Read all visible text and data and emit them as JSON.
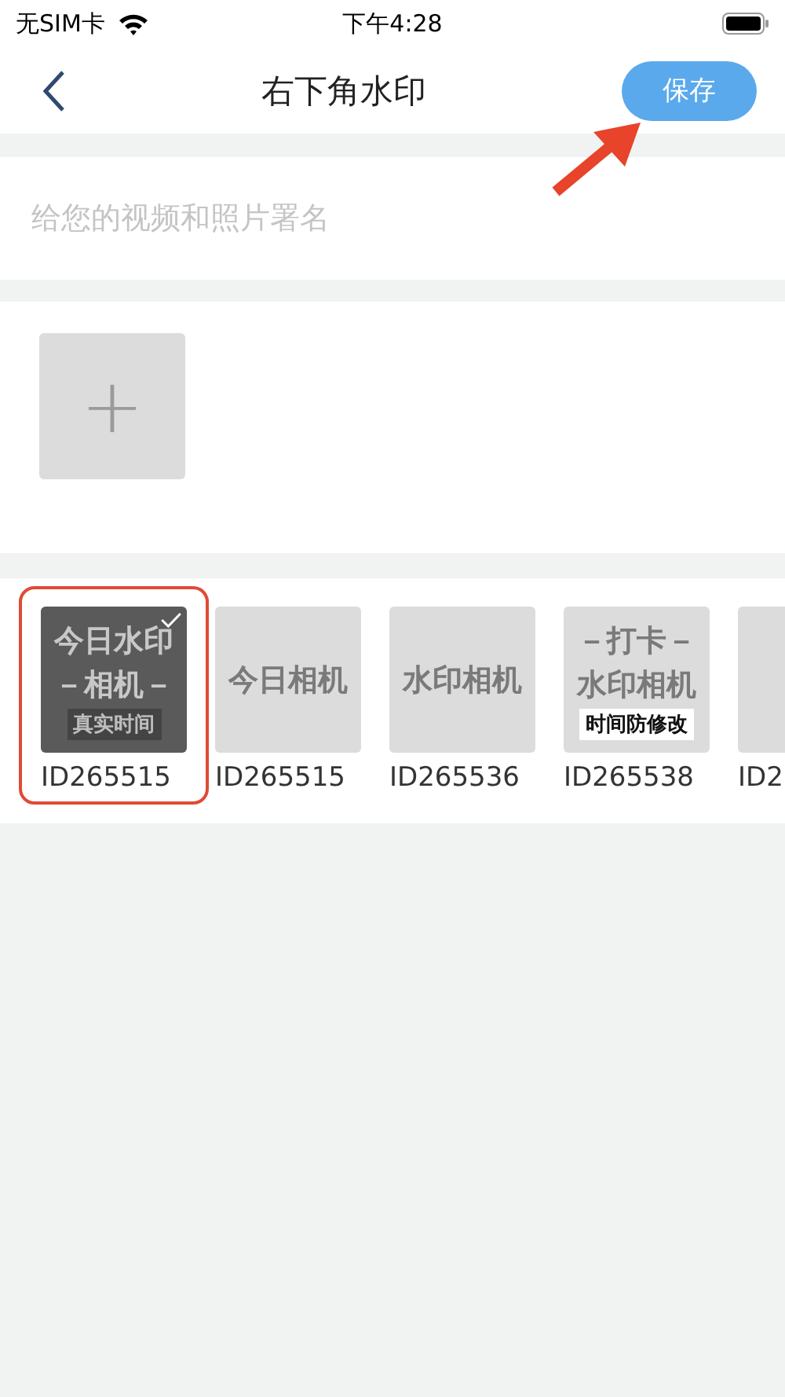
{
  "status_bar": {
    "carrier": "无SIM卡",
    "time": "下午4:28"
  },
  "nav": {
    "title": "右下角水印",
    "save_button": "保存"
  },
  "signature": {
    "placeholder": "给您的视频和照片署名"
  },
  "add_button": {
    "label": "+"
  },
  "thumbnails": [
    {
      "id": "ID265515",
      "selected": true,
      "lines": [
        {
          "text": "今日水印",
          "kind": "plain"
        },
        {
          "text": "－相机－",
          "kind": "plain"
        },
        {
          "text": "真实时间",
          "kind": "badge"
        }
      ]
    },
    {
      "id": "ID265515",
      "selected": false,
      "lines": [
        {
          "text": "今日相机",
          "kind": "plain"
        }
      ]
    },
    {
      "id": "ID265536",
      "selected": false,
      "lines": [
        {
          "text": "水印相机",
          "kind": "plain"
        }
      ]
    },
    {
      "id": "ID265538",
      "selected": false,
      "lines": [
        {
          "text": "－打卡－",
          "kind": "plain"
        },
        {
          "text": "水印相机",
          "kind": "plain"
        },
        {
          "text": "时间防修改",
          "kind": "badge"
        }
      ]
    },
    {
      "id": "ID2",
      "selected": false
    }
  ]
}
